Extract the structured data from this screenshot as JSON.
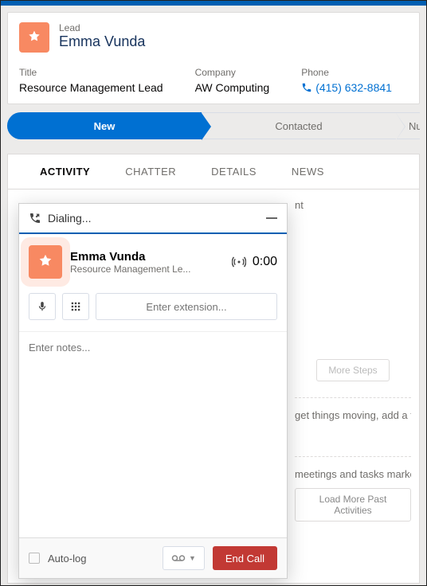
{
  "record": {
    "type_label": "Lead",
    "name": "Emma Vunda",
    "title_label": "Title",
    "title_value": "Resource Management Lead",
    "company_label": "Company",
    "company_value": "AW Computing",
    "phone_label": "Phone",
    "phone_value": "(415) 632-8841"
  },
  "path": {
    "stages": [
      "New",
      "Contacted",
      "Nu"
    ]
  },
  "tabs": {
    "items": [
      "ACTIVITY",
      "CHATTER",
      "DETAILS",
      "NEWS"
    ],
    "active": 0
  },
  "background": {
    "nt": "nt",
    "more_steps": "More Steps",
    "row1": "get things moving, add a task o",
    "row2": "meetings and tasks marked a",
    "load_more": "Load More Past Activities"
  },
  "dialer": {
    "status": "Dialing...",
    "callee_name": "Emma Vunda",
    "callee_title": "Resource Management Le...",
    "timer": "0:00",
    "extension_placeholder": "Enter extension...",
    "notes_placeholder": "Enter notes...",
    "autolog_label": "Auto-log",
    "vm_label": "∞ ▾",
    "end_label": "End Call"
  }
}
